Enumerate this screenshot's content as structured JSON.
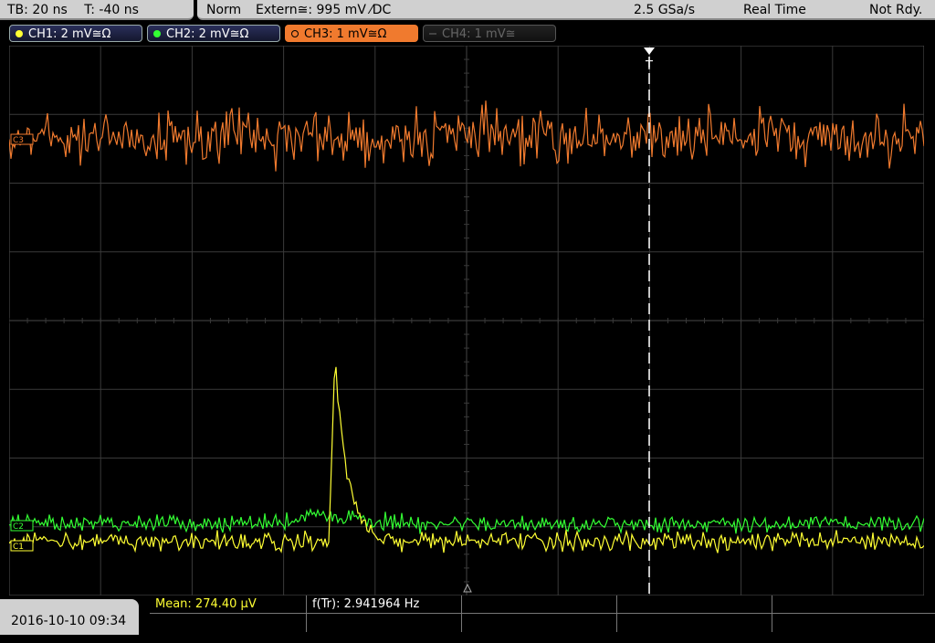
{
  "topbar": {
    "timebase": "TB: 20 ns",
    "trigger_time": "T: -40 ns",
    "mode": "Norm",
    "trigger_source": "Extern≅: 995 mV ⁄DC",
    "sample_rate": "2.5 GSa/s",
    "acq_mode": "Real Time",
    "status": "Not Rdy."
  },
  "channels": [
    {
      "label": "CH1: 2 mV≅Ω",
      "color": "#ffff33",
      "state": "on"
    },
    {
      "label": "CH2: 2 mV≅Ω",
      "color": "#33ff33",
      "state": "on"
    },
    {
      "label": "CH3: 1 mV≅Ω",
      "color": "#f07a2e",
      "state": "active"
    },
    {
      "label": "CH4: 1 mV≅",
      "color": "#666666",
      "state": "off"
    }
  ],
  "markers": {
    "ch3": "C3",
    "ch2": "C2",
    "ch1": "C1",
    "trigger": "T"
  },
  "bottom": {
    "datetime": "2016-10-10 09:34",
    "measurements": [
      {
        "label": "Mean: 274.40 µV",
        "color": "#ffff33"
      },
      {
        "label": "f(Tr): 2.941964 Hz",
        "color": "#ffffff"
      }
    ]
  },
  "colors": {
    "ch1": "#ffff33",
    "ch2": "#33ff33",
    "ch3": "#f07a2e",
    "grid": "#3a3a3a",
    "trigger_line": "#ffffff"
  }
}
